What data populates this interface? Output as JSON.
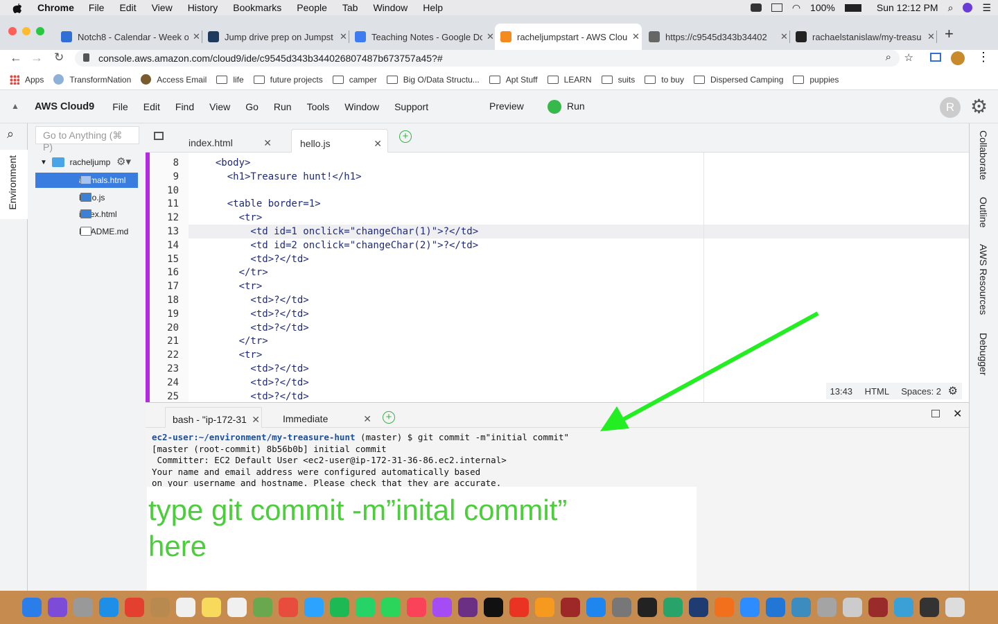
{
  "mac_menubar": {
    "apple": "",
    "app_name": "Chrome",
    "items": [
      "File",
      "Edit",
      "View",
      "History",
      "Bookmarks",
      "People",
      "Tab",
      "Window",
      "Help"
    ],
    "battery": "100%",
    "clock": "Sun 12:12 PM"
  },
  "browser_tabs": [
    {
      "title": "Notch8 - Calendar - Week o",
      "color": "#2f6fd6"
    },
    {
      "title": "Jump drive prep on Jumpst",
      "color": "#1e3a5f"
    },
    {
      "title": "Teaching Notes - Google Do",
      "color": "#3c7cf0"
    },
    {
      "title": "racheljumpstart - AWS Clou",
      "color": "#f58a1f"
    },
    {
      "title": "https://c9545d343b34402",
      "color": "#666666"
    },
    {
      "title": "rachaelstanislaw/my-treasu",
      "color": "#222222"
    }
  ],
  "address": {
    "url": "console.aws.amazon.com/cloud9/ide/c9545d343b344026807487b673757a45?#"
  },
  "bookmarks": [
    "Apps",
    "TransformNation",
    "Access Email",
    "life",
    "future projects",
    "camper",
    "Big O/Data Structu...",
    "Apt Stuff",
    "LEARN",
    "suits",
    "to buy",
    "Dispersed Camping",
    "puppies"
  ],
  "cloud9_menu": {
    "brand": "AWS Cloud9",
    "items": [
      "File",
      "Edit",
      "Find",
      "View",
      "Go",
      "Run",
      "Tools",
      "Window",
      "Support"
    ],
    "preview": "Preview",
    "run": "Run",
    "avatar": "R"
  },
  "sidebar": {
    "environment": "Environment",
    "search_placeholder": "Go to Anything (⌘ P)"
  },
  "file_tree": {
    "root": "racheljumpstart",
    "files": [
      "animals.html",
      "hello.js",
      "index.html",
      "README.md"
    ]
  },
  "editor_tabs": [
    "index.html",
    "hello.js"
  ],
  "code_lines": [
    {
      "n": "8",
      "code": "  <body>"
    },
    {
      "n": "9",
      "code": "    <h1>Treasure hunt!</h1>"
    },
    {
      "n": "10",
      "code": ""
    },
    {
      "n": "11",
      "code": "    <table border=1>"
    },
    {
      "n": "12",
      "code": "      <tr>"
    },
    {
      "n": "13",
      "code": "        <td id=1 onclick=\"changeChar(1)\">?</td>"
    },
    {
      "n": "14",
      "code": "        <td id=2 onclick=\"changeChar(2)\">?</td>"
    },
    {
      "n": "15",
      "code": "        <td>?</td>"
    },
    {
      "n": "16",
      "code": "      </tr>"
    },
    {
      "n": "17",
      "code": "      <tr>"
    },
    {
      "n": "18",
      "code": "        <td>?</td>"
    },
    {
      "n": "19",
      "code": "        <td>?</td>"
    },
    {
      "n": "20",
      "code": "        <td>?</td>"
    },
    {
      "n": "21",
      "code": "      </tr>"
    },
    {
      "n": "22",
      "code": "      <tr>"
    },
    {
      "n": "23",
      "code": "        <td>?</td>"
    },
    {
      "n": "24",
      "code": "        <td>?</td>"
    },
    {
      "n": "25",
      "code": "        <td>?</td>"
    }
  ],
  "status": {
    "position": "13:43",
    "language": "HTML",
    "spaces": "Spaces: 2"
  },
  "right_panel": [
    "Collaborate",
    "Outline",
    "AWS Resources",
    "Debugger"
  ],
  "terminal_tabs": [
    "bash - \"ip-172-31",
    "Immediate"
  ],
  "terminal": {
    "prompt_user": "ec2-user",
    "prompt_path": ":~/environment/my-treasure-hunt",
    "command": " (master) $ git commit -m\"initial commit\"",
    "output": "[master (root-commit) 8b56b0b] initial commit\n Committer: EC2 Default User <ec2-user@ip-172-31-36-86.ec2.internal>\nYour name and email address were configured automatically based\non your username and hostname. Please check that they are accurate."
  },
  "annotation": {
    "text": "type git commit -m”inital commit” here",
    "color": "#4ccd3b",
    "arrow_color": "#22ee22"
  },
  "dock_colors": [
    "#2b7de9",
    "#7c4bd8",
    "#999999",
    "#1e8fe6",
    "#e4402f",
    "#b98a4f",
    "#f0f0f0",
    "#f7d95b",
    "#f0f0f0",
    "#6aa84f",
    "#e84c3d",
    "#2ca3ff",
    "#1db954",
    "#25d366",
    "#2bd45a",
    "#fa4259",
    "#a54cf4",
    "#6b2f84",
    "#111111",
    "#ea3323",
    "#f59a1f",
    "#9e2727",
    "#1f86ef",
    "#777777",
    "#222222",
    "#28a36a",
    "#1e3c72",
    "#f2701b",
    "#2d8cff",
    "#2277d6",
    "#3c8cbf",
    "#a4a4a4",
    "#cccccc",
    "#9a2b2b",
    "#3aa0d6",
    "#333333",
    "#dddddd"
  ]
}
